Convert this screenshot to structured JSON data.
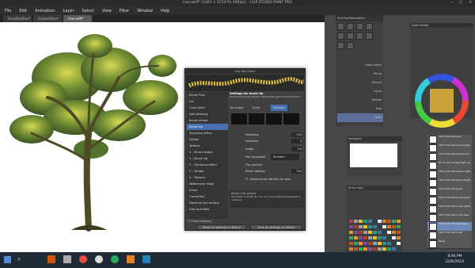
{
  "window": {
    "title": "tree.wklf* (1463 × 1219 Px 300dpi) - CLIP STUDIO PAINT PRO"
  },
  "menu": [
    "File",
    "Edit",
    "Animation",
    "Layer",
    "Select",
    "View",
    "Filter",
    "Window",
    "Help"
  ],
  "tabs": [
    {
      "label": "ScrollBarBlue*"
    },
    {
      "label": "SubjectBlue*"
    },
    {
      "label": "tree.wklf*",
      "active": true
    }
  ],
  "sub_tool_panel": {
    "title": "Sub Tool Decoration",
    "items": [
      "Grass patch",
      "Shrub",
      "Ground",
      "Cloud",
      "Rubble",
      "Twig",
      "Trees"
    ]
  },
  "dialog": {
    "title": "Sub Tool Detail",
    "heading": "Settings for brush tip",
    "description": "Set how brush tip shapes change with pen tilt and direction",
    "categories": [
      "Brush Size",
      "Ink",
      "Color Jitter",
      "Anti-aliasing",
      "Brush shape",
      "Brush tip",
      "Spraying effect",
      "Stroke",
      "Texture",
      "2 - Brush shape",
      "2 - Brush tip",
      "2 - Spraying effect",
      "2 - Stroke",
      "2 - Texture",
      "Watercolor edge",
      "Erase",
      "Correction",
      "Starting and ending",
      "Anti-overflow"
    ],
    "selected_category": "Brush tip",
    "tip_shape_label": "Tip shape",
    "tip_options": [
      "Circle",
      "Material"
    ],
    "hardness_label": "Hardness",
    "direction_label": "Direction",
    "direction_value": "0",
    "angle_label": "Angle",
    "angle_value": "0.0",
    "flip_horizontal_label": "Flip horizontal",
    "flip_horizontal_value": "Random",
    "flip_vertical_label": "Flip vertical",
    "brush_density_label": "Brush density",
    "brush_density_value": "100",
    "adjust_label": "Adjust brush density for gap",
    "about_label": "About [Tip shape]",
    "about_desc": "Set shape of brush tip. You can read material registered in material",
    "show_category_label": "Show category",
    "reset_button": "Reset all settings to default",
    "save_button": "Save all settings as default",
    "hardness_value": "100"
  },
  "navigator": {
    "title": "Navigator"
  },
  "brush_size": {
    "title": "Brush Size"
  },
  "color_wheel": {
    "title": "Color Wheel"
  },
  "layers": [
    "100 % Normal leaf",
    "100 % Normal brown highlights",
    "100 % Normal leaves trim",
    "61 % Color dodge light rays",
    "100 % Normal leaves highlights",
    "100 % Normal pinks bright",
    "100 % Normal grass",
    "100 % Normal trunk highlights",
    "100 % Normal trunk shadows",
    "100 % Normal trunk base",
    "100 % Normal tree base",
    "100 % Normal trunk",
    "Paper"
  ],
  "taskbar": {
    "time": "8:06 PM",
    "date": "2/26/2023"
  },
  "colors": {
    "canvas": "#ffffff",
    "selection": "#4a6fae",
    "panel": "#474747"
  }
}
